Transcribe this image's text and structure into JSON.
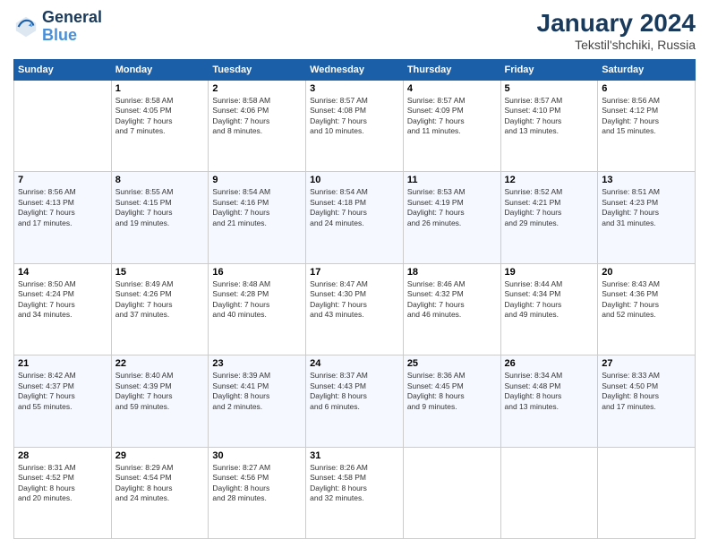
{
  "logo": {
    "line1": "General",
    "line2": "Blue"
  },
  "title": "January 2024",
  "subtitle": "Tekstil'shchiki, Russia",
  "days_header": [
    "Sunday",
    "Monday",
    "Tuesday",
    "Wednesday",
    "Thursday",
    "Friday",
    "Saturday"
  ],
  "weeks": [
    [
      {
        "day": "",
        "info": ""
      },
      {
        "day": "1",
        "info": "Sunrise: 8:58 AM\nSunset: 4:05 PM\nDaylight: 7 hours\nand 7 minutes."
      },
      {
        "day": "2",
        "info": "Sunrise: 8:58 AM\nSunset: 4:06 PM\nDaylight: 7 hours\nand 8 minutes."
      },
      {
        "day": "3",
        "info": "Sunrise: 8:57 AM\nSunset: 4:08 PM\nDaylight: 7 hours\nand 10 minutes."
      },
      {
        "day": "4",
        "info": "Sunrise: 8:57 AM\nSunset: 4:09 PM\nDaylight: 7 hours\nand 11 minutes."
      },
      {
        "day": "5",
        "info": "Sunrise: 8:57 AM\nSunset: 4:10 PM\nDaylight: 7 hours\nand 13 minutes."
      },
      {
        "day": "6",
        "info": "Sunrise: 8:56 AM\nSunset: 4:12 PM\nDaylight: 7 hours\nand 15 minutes."
      }
    ],
    [
      {
        "day": "7",
        "info": "Sunrise: 8:56 AM\nSunset: 4:13 PM\nDaylight: 7 hours\nand 17 minutes."
      },
      {
        "day": "8",
        "info": "Sunrise: 8:55 AM\nSunset: 4:15 PM\nDaylight: 7 hours\nand 19 minutes."
      },
      {
        "day": "9",
        "info": "Sunrise: 8:54 AM\nSunset: 4:16 PM\nDaylight: 7 hours\nand 21 minutes."
      },
      {
        "day": "10",
        "info": "Sunrise: 8:54 AM\nSunset: 4:18 PM\nDaylight: 7 hours\nand 24 minutes."
      },
      {
        "day": "11",
        "info": "Sunrise: 8:53 AM\nSunset: 4:19 PM\nDaylight: 7 hours\nand 26 minutes."
      },
      {
        "day": "12",
        "info": "Sunrise: 8:52 AM\nSunset: 4:21 PM\nDaylight: 7 hours\nand 29 minutes."
      },
      {
        "day": "13",
        "info": "Sunrise: 8:51 AM\nSunset: 4:23 PM\nDaylight: 7 hours\nand 31 minutes."
      }
    ],
    [
      {
        "day": "14",
        "info": "Sunrise: 8:50 AM\nSunset: 4:24 PM\nDaylight: 7 hours\nand 34 minutes."
      },
      {
        "day": "15",
        "info": "Sunrise: 8:49 AM\nSunset: 4:26 PM\nDaylight: 7 hours\nand 37 minutes."
      },
      {
        "day": "16",
        "info": "Sunrise: 8:48 AM\nSunset: 4:28 PM\nDaylight: 7 hours\nand 40 minutes."
      },
      {
        "day": "17",
        "info": "Sunrise: 8:47 AM\nSunset: 4:30 PM\nDaylight: 7 hours\nand 43 minutes."
      },
      {
        "day": "18",
        "info": "Sunrise: 8:46 AM\nSunset: 4:32 PM\nDaylight: 7 hours\nand 46 minutes."
      },
      {
        "day": "19",
        "info": "Sunrise: 8:44 AM\nSunset: 4:34 PM\nDaylight: 7 hours\nand 49 minutes."
      },
      {
        "day": "20",
        "info": "Sunrise: 8:43 AM\nSunset: 4:36 PM\nDaylight: 7 hours\nand 52 minutes."
      }
    ],
    [
      {
        "day": "21",
        "info": "Sunrise: 8:42 AM\nSunset: 4:37 PM\nDaylight: 7 hours\nand 55 minutes."
      },
      {
        "day": "22",
        "info": "Sunrise: 8:40 AM\nSunset: 4:39 PM\nDaylight: 7 hours\nand 59 minutes."
      },
      {
        "day": "23",
        "info": "Sunrise: 8:39 AM\nSunset: 4:41 PM\nDaylight: 8 hours\nand 2 minutes."
      },
      {
        "day": "24",
        "info": "Sunrise: 8:37 AM\nSunset: 4:43 PM\nDaylight: 8 hours\nand 6 minutes."
      },
      {
        "day": "25",
        "info": "Sunrise: 8:36 AM\nSunset: 4:45 PM\nDaylight: 8 hours\nand 9 minutes."
      },
      {
        "day": "26",
        "info": "Sunrise: 8:34 AM\nSunset: 4:48 PM\nDaylight: 8 hours\nand 13 minutes."
      },
      {
        "day": "27",
        "info": "Sunrise: 8:33 AM\nSunset: 4:50 PM\nDaylight: 8 hours\nand 17 minutes."
      }
    ],
    [
      {
        "day": "28",
        "info": "Sunrise: 8:31 AM\nSunset: 4:52 PM\nDaylight: 8 hours\nand 20 minutes."
      },
      {
        "day": "29",
        "info": "Sunrise: 8:29 AM\nSunset: 4:54 PM\nDaylight: 8 hours\nand 24 minutes."
      },
      {
        "day": "30",
        "info": "Sunrise: 8:27 AM\nSunset: 4:56 PM\nDaylight: 8 hours\nand 28 minutes."
      },
      {
        "day": "31",
        "info": "Sunrise: 8:26 AM\nSunset: 4:58 PM\nDaylight: 8 hours\nand 32 minutes."
      },
      {
        "day": "",
        "info": ""
      },
      {
        "day": "",
        "info": ""
      },
      {
        "day": "",
        "info": ""
      }
    ]
  ]
}
